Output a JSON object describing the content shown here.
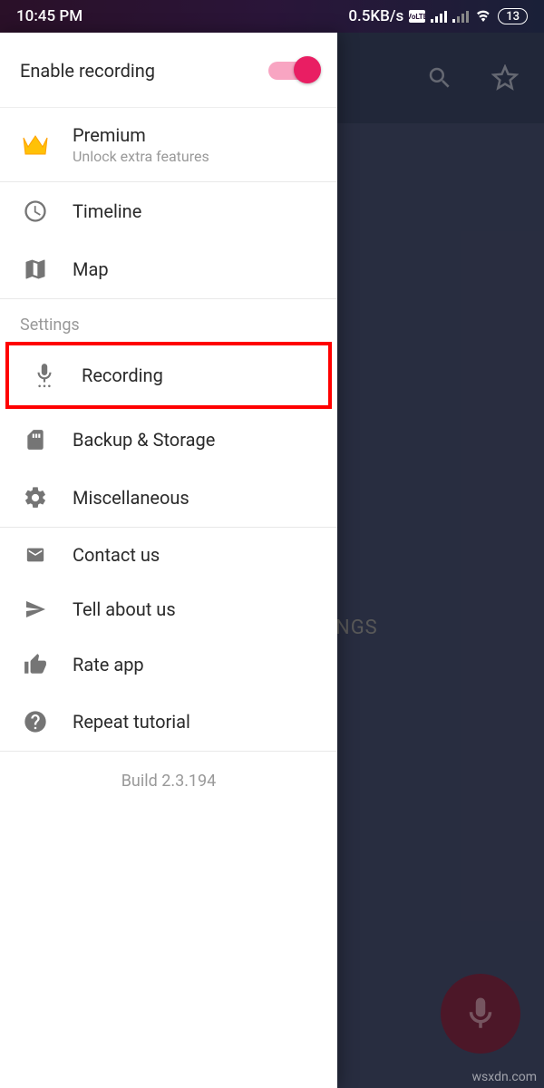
{
  "status": {
    "time": "10:45 PM",
    "network_speed": "0.5KB/s",
    "battery": "13"
  },
  "app": {
    "bg_partial_text": "NGS"
  },
  "drawer": {
    "enable_label": "Enable recording",
    "premium": {
      "title": "Premium",
      "subtitle": "Unlock extra features"
    },
    "items_nav": [
      {
        "label": "Timeline"
      },
      {
        "label": "Map"
      }
    ],
    "settings_header": "Settings",
    "items_settings": [
      {
        "label": "Recording"
      },
      {
        "label": "Backup & Storage"
      },
      {
        "label": "Miscellaneous"
      }
    ],
    "items_about": [
      {
        "label": "Contact us"
      },
      {
        "label": "Tell about us"
      },
      {
        "label": "Rate app"
      },
      {
        "label": "Repeat tutorial"
      }
    ],
    "build": "Build 2.3.194"
  },
  "watermark": "wsxdn.com"
}
